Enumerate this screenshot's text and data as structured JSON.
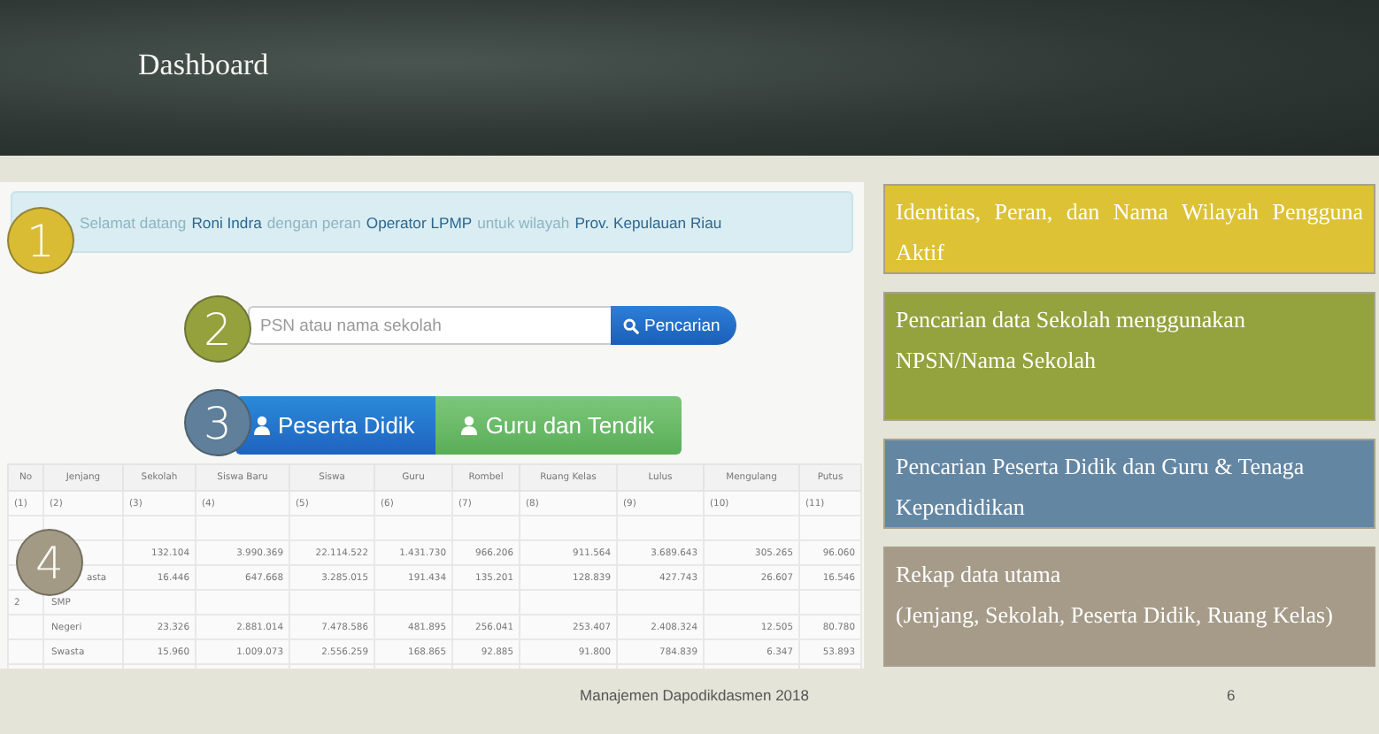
{
  "slide": {
    "title": "Dashboard",
    "footer": "Manajemen Dapodikdasmen 2018",
    "page_number": "6"
  },
  "welcome": {
    "parts": [
      {
        "text": "Selamat datang",
        "highlight": false
      },
      {
        "text": "Roni Indra",
        "highlight": true
      },
      {
        "text": "dengan peran",
        "highlight": false
      },
      {
        "text": "Operator LPMP",
        "highlight": true
      },
      {
        "text": "untuk wilayah",
        "highlight": false
      },
      {
        "text": "Prov. Kepulauan Riau",
        "highlight": true
      }
    ]
  },
  "search": {
    "placeholder": "PSN atau nama sekolah",
    "button": "Pencarian"
  },
  "buttons": [
    {
      "label": "Peserta Didik",
      "kind": "primary"
    },
    {
      "label": "Guru dan Tendik",
      "kind": "success"
    }
  ],
  "table": {
    "columns": [
      "No",
      "Jenjang",
      "Sekolah",
      "Siswa Baru",
      "Siswa",
      "Guru",
      "Rombel",
      "Ruang Kelas",
      "Lulus",
      "Mengulang",
      "Putus"
    ],
    "index_row": [
      "(1)",
      "(2)",
      "(3)",
      "(4)",
      "(5)",
      "(6)",
      "(7)",
      "(8)",
      "(9)",
      "(10)",
      "(11)"
    ],
    "rows": [
      [
        null,
        null,
        null,
        null,
        null,
        null,
        null,
        null,
        null,
        null,
        null
      ],
      [
        null,
        null,
        "132.104",
        "3.990.369",
        "22.114.522",
        "1.431.730",
        "966.206",
        "911.564",
        "3.689.643",
        "305.265",
        "96.060"
      ],
      [
        null,
        "asta",
        "16.446",
        "647.668",
        "3.285.015",
        "191.434",
        "135.201",
        "128.839",
        "427.743",
        "26.607",
        "16.546"
      ],
      [
        "2",
        "SMP",
        null,
        null,
        null,
        null,
        null,
        null,
        null,
        null,
        null
      ],
      [
        null,
        "Negeri",
        "23.326",
        "2.881.014",
        "7.478.586",
        "481.895",
        "256.041",
        "253.407",
        "2.408.324",
        "12.505",
        "80.780"
      ],
      [
        null,
        "Swasta",
        "15.960",
        "1.009.073",
        "2.556.259",
        "168.865",
        "92.885",
        "91.800",
        "784.839",
        "6.347",
        "53.893"
      ]
    ]
  },
  "markers": [
    {
      "label": "1",
      "color": "#d9bc34"
    },
    {
      "label": "2",
      "color": "#94a13c"
    },
    {
      "label": "3",
      "color": "#5f7f9b"
    },
    {
      "label": "4",
      "color": "#a39a86"
    }
  ],
  "notes": [
    {
      "lines": [
        "Identitas, Peran, dan Nama Wilayah Pengguna Aktif"
      ],
      "color": "#dcc234"
    },
    {
      "lines": [
        "Pencarian data Sekolah menggunakan",
        "NPSN/Nama Sekolah"
      ],
      "color": "#95a33e"
    },
    {
      "lines": [
        "Pencarian Peserta Didik dan Guru & Tenaga Kependidikan"
      ],
      "color": "#6386a3"
    },
    {
      "lines": [
        "Rekap data utama",
        "(Jenjang, Sekolah, Peserta Didik, Ruang Kelas)"
      ],
      "color": "#a59b88"
    }
  ]
}
